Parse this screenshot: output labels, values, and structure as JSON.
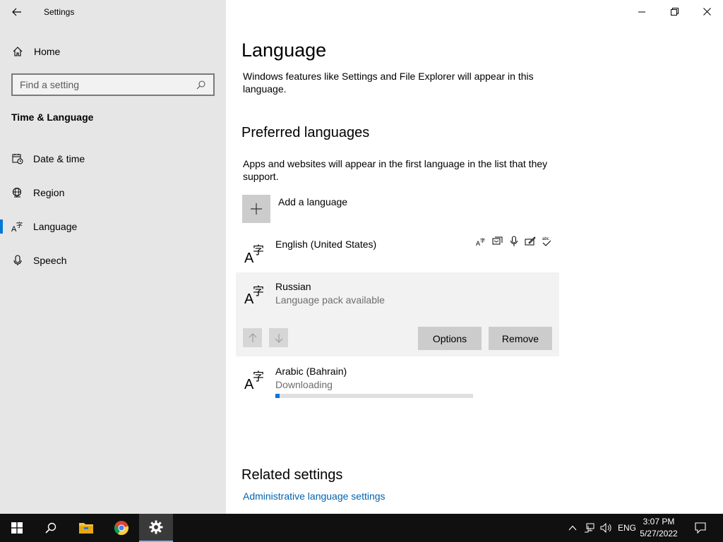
{
  "window": {
    "app_title": "Settings"
  },
  "sidebar": {
    "home_label": "Home",
    "search_placeholder": "Find a setting",
    "section_title": "Time & Language",
    "items": [
      {
        "label": "Date & time",
        "icon": "calendar-clock-icon"
      },
      {
        "label": "Region",
        "icon": "globe-icon"
      },
      {
        "label": "Language",
        "icon": "language-icon",
        "active": true
      },
      {
        "label": "Speech",
        "icon": "microphone-icon"
      }
    ]
  },
  "main": {
    "title": "Language",
    "display_desc": "Windows features like Settings and File Explorer will appear in this language.",
    "preferred_heading": "Preferred languages",
    "preferred_desc": "Apps and websites will appear in the first language in the list that they support.",
    "add_language_label": "Add a language",
    "languages": [
      {
        "name": "English (United States)",
        "status": "",
        "feature_icons": [
          "display-language-icon",
          "speech-icon",
          "microphone-icon",
          "handwriting-icon",
          "spellcheck-icon"
        ]
      },
      {
        "name": "Russian",
        "status": "Language pack available",
        "selected": true
      },
      {
        "name": "Arabic (Bahrain)",
        "status": "Downloading",
        "progress_percent": 2
      }
    ],
    "options_label": "Options",
    "remove_label": "Remove",
    "related_heading": "Related settings",
    "admin_link": "Administrative language settings"
  },
  "taskbar": {
    "language_indicator": "ENG",
    "time": "3:07 PM",
    "date": "5/27/2022"
  },
  "colors": {
    "accent": "#0078d7",
    "link": "#0063b1",
    "sidebar_bg": "#e6e6e6",
    "taskbar_bg": "#101010"
  }
}
